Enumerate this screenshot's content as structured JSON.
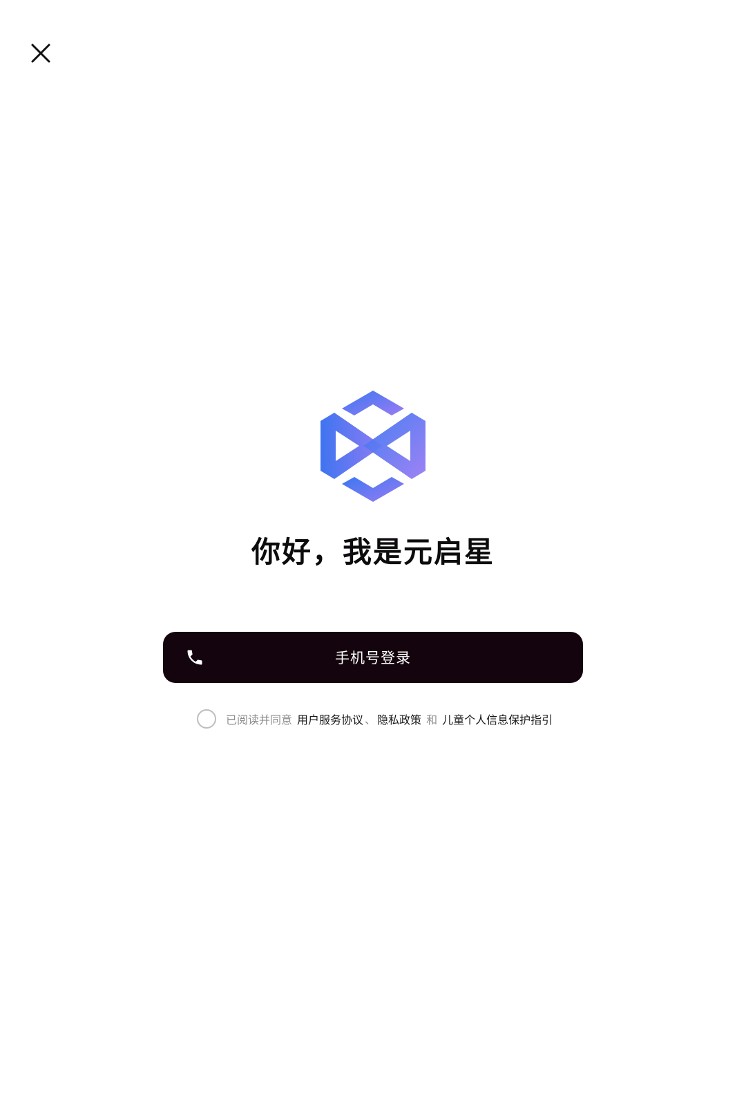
{
  "header": {
    "close_icon": "close-icon"
  },
  "brand": {
    "logo_icon": "yuanqixing-logo-icon",
    "colors": {
      "gradient_start": "#3a78f2",
      "gradient_end": "#9a7bf3"
    }
  },
  "welcome": {
    "title": "你好，我是元启星"
  },
  "login": {
    "button_label": "手机号登录",
    "icon": "phone-icon",
    "background_color": "#14040d"
  },
  "agreement": {
    "checked": false,
    "prefix": "已阅读并同意",
    "terms_link": "用户服务协议",
    "separator": "、",
    "privacy_link": "隐私政策",
    "conjunction": "和",
    "children_link": "儿童个人信息保护指引"
  }
}
